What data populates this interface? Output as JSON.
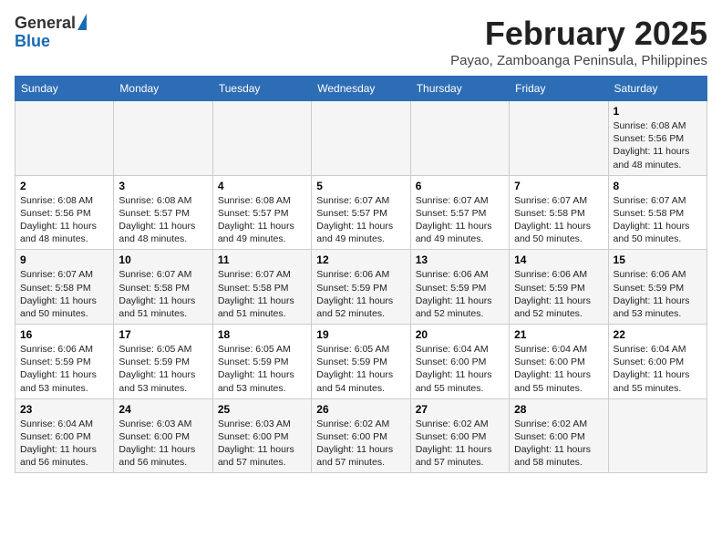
{
  "header": {
    "logo_general": "General",
    "logo_blue": "Blue",
    "title": "February 2025",
    "subtitle": "Payao, Zamboanga Peninsula, Philippines"
  },
  "weekdays": [
    "Sunday",
    "Monday",
    "Tuesday",
    "Wednesday",
    "Thursday",
    "Friday",
    "Saturday"
  ],
  "weeks": [
    [
      {
        "day": "",
        "info": ""
      },
      {
        "day": "",
        "info": ""
      },
      {
        "day": "",
        "info": ""
      },
      {
        "day": "",
        "info": ""
      },
      {
        "day": "",
        "info": ""
      },
      {
        "day": "",
        "info": ""
      },
      {
        "day": "1",
        "info": "Sunrise: 6:08 AM\nSunset: 5:56 PM\nDaylight: 11 hours and 48 minutes."
      }
    ],
    [
      {
        "day": "2",
        "info": "Sunrise: 6:08 AM\nSunset: 5:56 PM\nDaylight: 11 hours and 48 minutes."
      },
      {
        "day": "3",
        "info": "Sunrise: 6:08 AM\nSunset: 5:57 PM\nDaylight: 11 hours and 48 minutes."
      },
      {
        "day": "4",
        "info": "Sunrise: 6:08 AM\nSunset: 5:57 PM\nDaylight: 11 hours and 49 minutes."
      },
      {
        "day": "5",
        "info": "Sunrise: 6:07 AM\nSunset: 5:57 PM\nDaylight: 11 hours and 49 minutes."
      },
      {
        "day": "6",
        "info": "Sunrise: 6:07 AM\nSunset: 5:57 PM\nDaylight: 11 hours and 49 minutes."
      },
      {
        "day": "7",
        "info": "Sunrise: 6:07 AM\nSunset: 5:58 PM\nDaylight: 11 hours and 50 minutes."
      },
      {
        "day": "8",
        "info": "Sunrise: 6:07 AM\nSunset: 5:58 PM\nDaylight: 11 hours and 50 minutes."
      }
    ],
    [
      {
        "day": "9",
        "info": "Sunrise: 6:07 AM\nSunset: 5:58 PM\nDaylight: 11 hours and 50 minutes."
      },
      {
        "day": "10",
        "info": "Sunrise: 6:07 AM\nSunset: 5:58 PM\nDaylight: 11 hours and 51 minutes."
      },
      {
        "day": "11",
        "info": "Sunrise: 6:07 AM\nSunset: 5:58 PM\nDaylight: 11 hours and 51 minutes."
      },
      {
        "day": "12",
        "info": "Sunrise: 6:06 AM\nSunset: 5:59 PM\nDaylight: 11 hours and 52 minutes."
      },
      {
        "day": "13",
        "info": "Sunrise: 6:06 AM\nSunset: 5:59 PM\nDaylight: 11 hours and 52 minutes."
      },
      {
        "day": "14",
        "info": "Sunrise: 6:06 AM\nSunset: 5:59 PM\nDaylight: 11 hours and 52 minutes."
      },
      {
        "day": "15",
        "info": "Sunrise: 6:06 AM\nSunset: 5:59 PM\nDaylight: 11 hours and 53 minutes."
      }
    ],
    [
      {
        "day": "16",
        "info": "Sunrise: 6:06 AM\nSunset: 5:59 PM\nDaylight: 11 hours and 53 minutes."
      },
      {
        "day": "17",
        "info": "Sunrise: 6:05 AM\nSunset: 5:59 PM\nDaylight: 11 hours and 53 minutes."
      },
      {
        "day": "18",
        "info": "Sunrise: 6:05 AM\nSunset: 5:59 PM\nDaylight: 11 hours and 53 minutes."
      },
      {
        "day": "19",
        "info": "Sunrise: 6:05 AM\nSunset: 5:59 PM\nDaylight: 11 hours and 54 minutes."
      },
      {
        "day": "20",
        "info": "Sunrise: 6:04 AM\nSunset: 6:00 PM\nDaylight: 11 hours and 55 minutes."
      },
      {
        "day": "21",
        "info": "Sunrise: 6:04 AM\nSunset: 6:00 PM\nDaylight: 11 hours and 55 minutes."
      },
      {
        "day": "22",
        "info": "Sunrise: 6:04 AM\nSunset: 6:00 PM\nDaylight: 11 hours and 55 minutes."
      }
    ],
    [
      {
        "day": "23",
        "info": "Sunrise: 6:04 AM\nSunset: 6:00 PM\nDaylight: 11 hours and 56 minutes."
      },
      {
        "day": "24",
        "info": "Sunrise: 6:03 AM\nSunset: 6:00 PM\nDaylight: 11 hours and 56 minutes."
      },
      {
        "day": "25",
        "info": "Sunrise: 6:03 AM\nSunset: 6:00 PM\nDaylight: 11 hours and 57 minutes."
      },
      {
        "day": "26",
        "info": "Sunrise: 6:02 AM\nSunset: 6:00 PM\nDaylight: 11 hours and 57 minutes."
      },
      {
        "day": "27",
        "info": "Sunrise: 6:02 AM\nSunset: 6:00 PM\nDaylight: 11 hours and 57 minutes."
      },
      {
        "day": "28",
        "info": "Sunrise: 6:02 AM\nSunset: 6:00 PM\nDaylight: 11 hours and 58 minutes."
      },
      {
        "day": "",
        "info": ""
      }
    ]
  ]
}
